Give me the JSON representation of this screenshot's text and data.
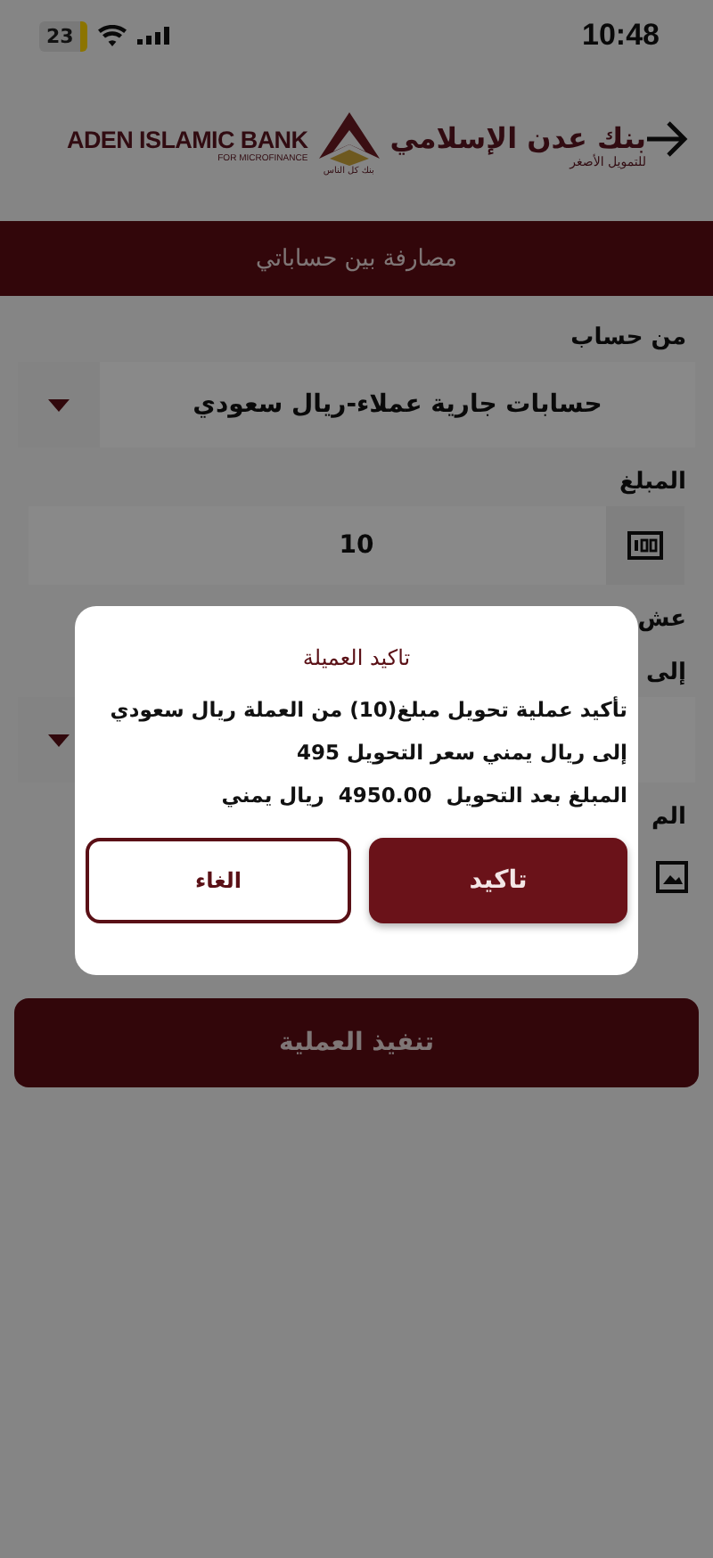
{
  "status_bar": {
    "time": "10:48",
    "battery": "23"
  },
  "header": {
    "bank_name_en": "ADEN ISLAMIC BANK",
    "tagline_en": "FOR MICROFINANCE",
    "bank_name_ar": "بنك عدن الإسلامي",
    "tagline_ar": "للتمويل الأصغر",
    "slogan_ar": "بنك كل الناس"
  },
  "title": "مصارفة بين حساباتي",
  "form": {
    "fields": [
      {
        "kind": "select",
        "label": "من حساب",
        "value": "حسابات جارية عملاء-ريال سعودي"
      },
      {
        "kind": "amount",
        "label": "المبلغ",
        "value": "10"
      },
      {
        "kind": "note",
        "label": "عش"
      },
      {
        "kind": "select",
        "label": "إلى"
      },
      {
        "kind": "attachment",
        "label": "الم"
      }
    ]
  },
  "submit": "تنفيذ العملية",
  "dialog": {
    "title": "تاكيد العميلة",
    "message": "تأكيد عملية تحويل مبلغ(10) من العملة ريال سعودي إلى ريال يمني سعر التحويل 495",
    "total": "المبلغ بعد التحويل  4950.00  ريال يمني",
    "buttons": [
      {
        "kind": "primary",
        "label": "تاكيد"
      },
      {
        "kind": "secondary",
        "label": "الغاء"
      }
    ]
  }
}
